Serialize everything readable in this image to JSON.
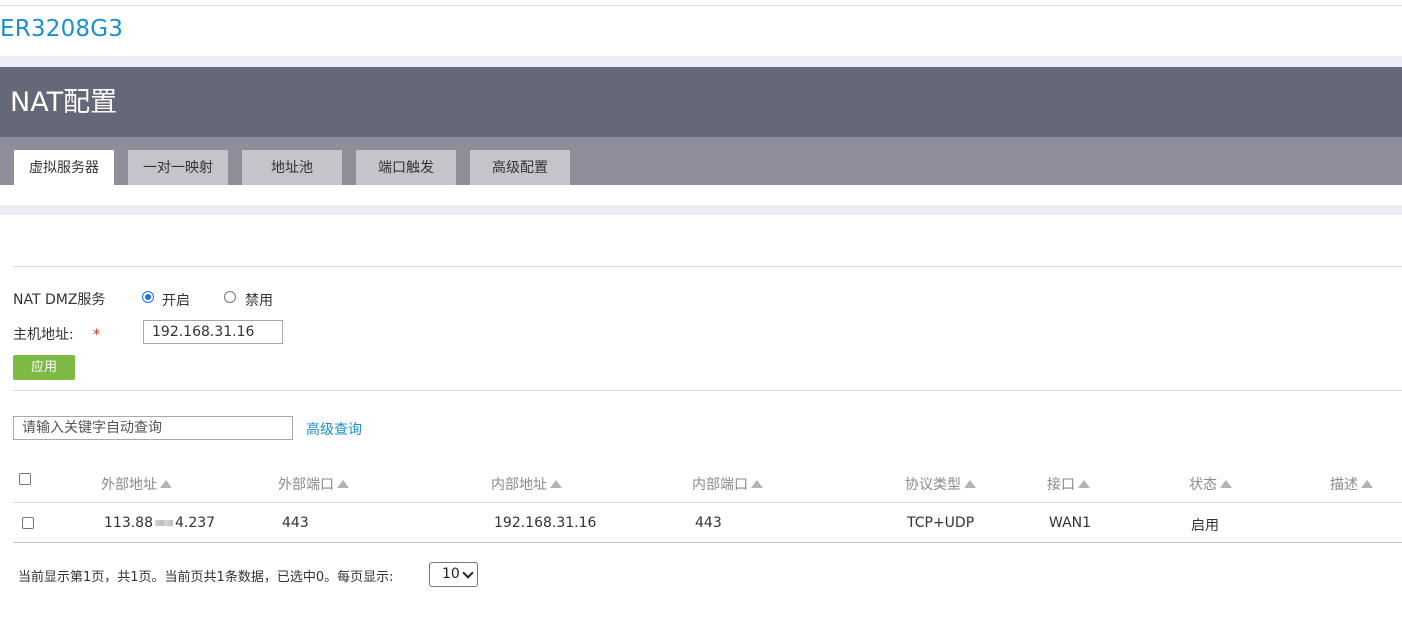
{
  "device": {
    "name": "ER3208G3"
  },
  "page": {
    "title": "NAT配置"
  },
  "tabs": [
    {
      "label": "虚拟服务器",
      "active": true
    },
    {
      "label": "一对一映射",
      "active": false
    },
    {
      "label": "地址池",
      "active": false
    },
    {
      "label": "端口触发",
      "active": false
    },
    {
      "label": "高级配置",
      "active": false
    }
  ],
  "dmz": {
    "label": "NAT DMZ服务",
    "options": [
      {
        "label": "开启",
        "checked": true
      },
      {
        "label": "禁用",
        "checked": false
      }
    ],
    "host_label": "主机地址:",
    "required_mark": "*",
    "host_value": "192.168.31.16",
    "apply_label": "应用"
  },
  "search": {
    "placeholder": "请输入关键字自动查询",
    "advanced_label": "高级查询"
  },
  "table": {
    "columns": [
      "外部地址",
      "外部端口",
      "内部地址",
      "内部端口",
      "协议类型",
      "接口",
      "状态",
      "描述"
    ],
    "rows": [
      {
        "external_addr_prefix": "113.88",
        "external_addr_suffix": "4.237",
        "external_port": "443",
        "internal_addr": "192.168.31.16",
        "internal_port": "443",
        "protocol": "TCP+UDP",
        "interface": "WAN1",
        "status": "启用",
        "description": ""
      }
    ]
  },
  "pager": {
    "text": "当前显示第1页，共1页。当前页共1条数据，已选中0。每页显示:",
    "page_size": "10"
  },
  "colors": {
    "accent": "#1a8fd0",
    "header_bg": "#656876",
    "tabbar_bg": "#8d8e99",
    "apply_button": "#7dba44",
    "required": "#e0281f"
  },
  "icons": {
    "sort": "triangle-up",
    "dropdown": "chevron-down"
  }
}
